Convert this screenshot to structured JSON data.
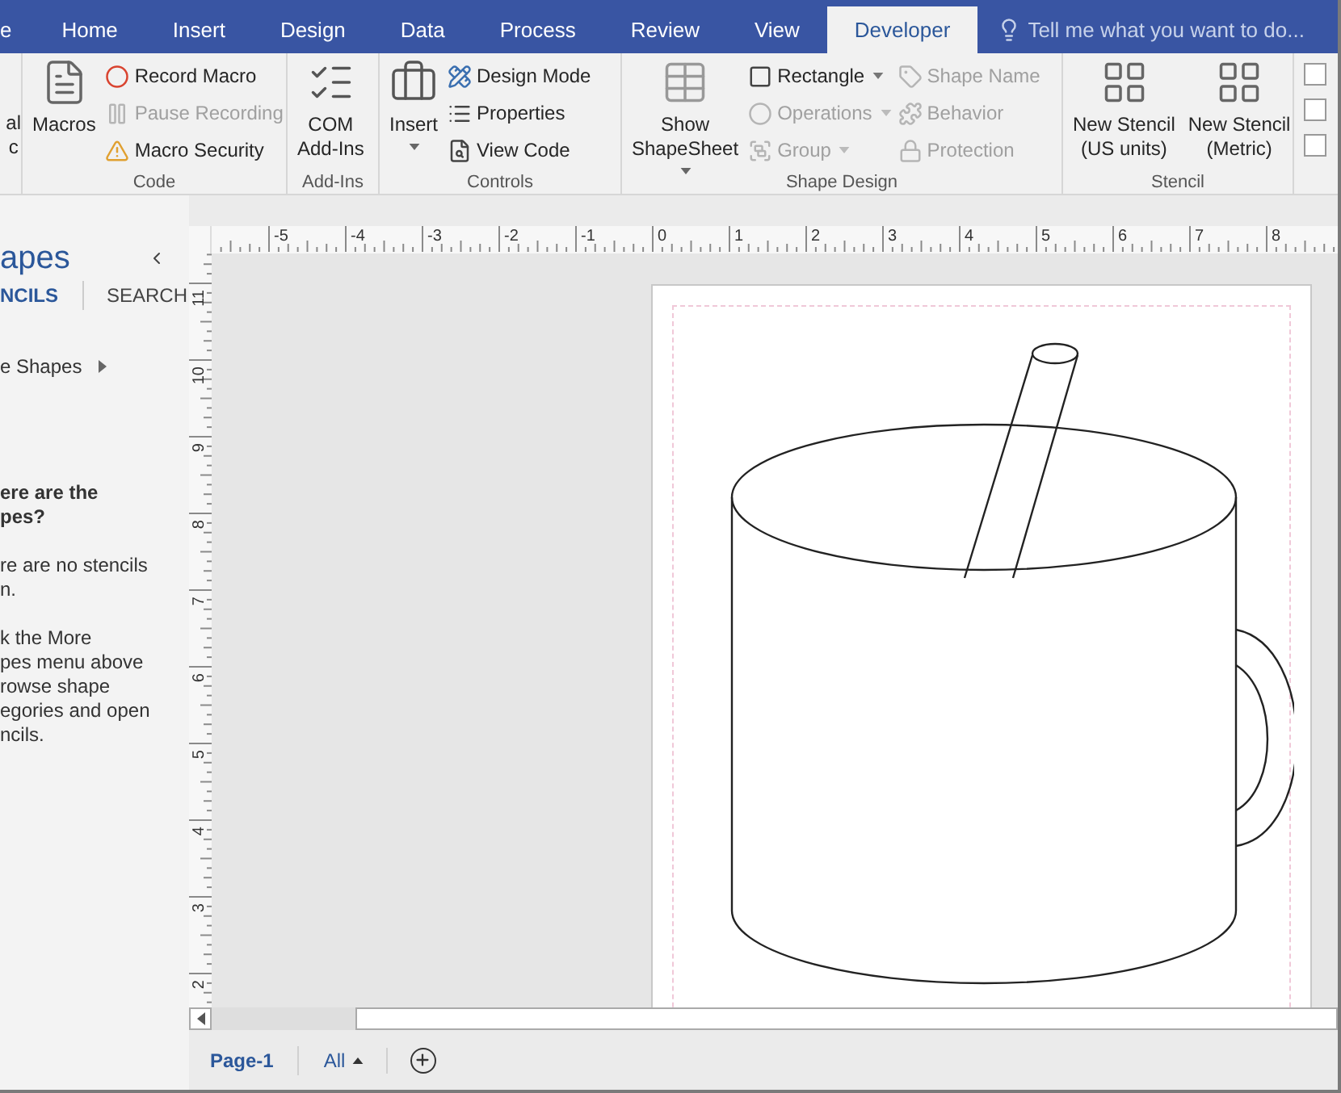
{
  "tabs": [
    {
      "label": "e",
      "selected": false
    },
    {
      "label": "Home",
      "selected": false
    },
    {
      "label": "Insert",
      "selected": false
    },
    {
      "label": "Design",
      "selected": false
    },
    {
      "label": "Data",
      "selected": false
    },
    {
      "label": "Process",
      "selected": false
    },
    {
      "label": "Review",
      "selected": false
    },
    {
      "label": "View",
      "selected": false
    },
    {
      "label": "Developer",
      "selected": true
    }
  ],
  "tell_me": {
    "placeholder": "Tell me what you want to do..."
  },
  "ribbon": {
    "groups": [
      {
        "columns": [
          {
            "kind": "large",
            "label": "al\nc",
            "disabled": false
          }
        ]
      },
      {
        "label": "Code",
        "columns": [
          {
            "kind": "large",
            "label": "Macros",
            "disabled": false
          },
          {
            "kind": "stack",
            "items": [
              {
                "label": "Record Macro",
                "disabled": false
              },
              {
                "label": "Pause Recording",
                "disabled": true
              },
              {
                "label": "Macro Security",
                "disabled": false
              }
            ]
          }
        ]
      },
      {
        "label": "Add-Ins",
        "columns": [
          {
            "kind": "large",
            "label": "COM\nAdd-Ins",
            "disabled": false
          }
        ]
      },
      {
        "label": "Controls",
        "columns": [
          {
            "kind": "large",
            "label": "Insert",
            "disabled": false,
            "dropdown": true
          },
          {
            "kind": "stack",
            "items": [
              {
                "label": "Design Mode",
                "disabled": false
              },
              {
                "label": "Properties",
                "disabled": false
              },
              {
                "label": "View Code",
                "disabled": false
              }
            ]
          }
        ]
      },
      {
        "label": "Shape Design",
        "columns": [
          {
            "kind": "large",
            "label": "Show\nShapeSheet",
            "disabled": false,
            "dropdown": true
          },
          {
            "kind": "stack",
            "items": [
              {
                "label": "Rectangle",
                "disabled": false,
                "dropdown": true
              },
              {
                "label": "Operations",
                "disabled": true,
                "dropdown": true
              },
              {
                "label": "Group",
                "disabled": true,
                "dropdown": true
              }
            ]
          },
          {
            "kind": "stack",
            "items": [
              {
                "label": "Shape Name",
                "disabled": true
              },
              {
                "label": "Behavior",
                "disabled": true
              },
              {
                "label": "Protection",
                "disabled": true
              }
            ]
          }
        ]
      },
      {
        "label": "Stencil",
        "columns": [
          {
            "kind": "large",
            "label": "New Stencil\n(US units)",
            "disabled": false
          },
          {
            "kind": "large",
            "label": "New Stencil\n(Metric)",
            "disabled": false
          }
        ]
      },
      {
        "columns": [
          {
            "kind": "checks",
            "items": [
              {
                "checked": false
              },
              {
                "checked": false
              },
              {
                "checked": false
              }
            ]
          }
        ]
      }
    ]
  },
  "shapes_panel": {
    "title": "apes",
    "tabs": [
      {
        "label": "NCILS",
        "selected": true
      },
      {
        "label": "SEARCH",
        "selected": false
      }
    ],
    "more_shapes": "e Shapes",
    "heading": "ere are the\npes?",
    "paragraphs": [
      "re are no stencils\nn.",
      "k the More\npes menu above\nrowse shape\negories and open\nncils."
    ]
  },
  "rulers": {
    "horizontal": [
      "-5",
      "-4",
      "-3",
      "-2",
      "-1",
      "0",
      "1",
      "2",
      "3",
      "4",
      "5",
      "6",
      "7",
      "8"
    ],
    "vertical": [
      "11",
      "10",
      "9",
      "8",
      "7",
      "6",
      "5",
      "4",
      "3",
      "2"
    ]
  },
  "page_tabs": [
    {
      "label": "Page-1",
      "selected": true
    },
    {
      "label": "All",
      "selected": false
    }
  ]
}
